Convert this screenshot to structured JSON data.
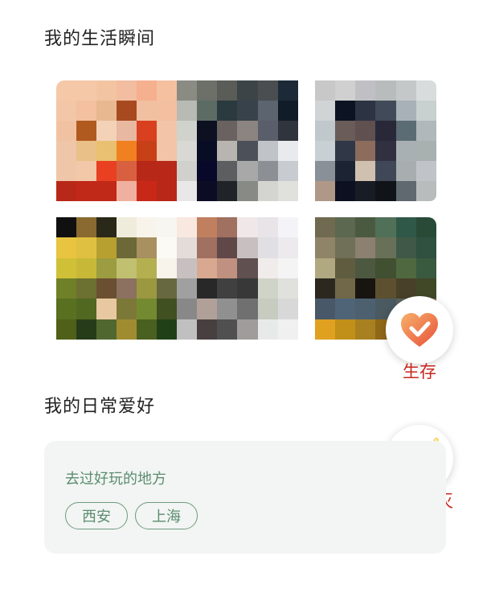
{
  "sections": {
    "moments_title": "我的生活瞬间",
    "hobbies_title": "我的日常爱好"
  },
  "photos": [
    {
      "name": "photo-1",
      "colors": [
        "#f5c8a8",
        "#f5c8a8",
        "#f3c4a2",
        "#f2bda0",
        "#f5b090",
        "#f5c0a0",
        "#f2c6a6",
        "#f3c0a0",
        "#e8b890",
        "#a84a20",
        "#f0c0a0",
        "#f2c0a0",
        "#f0c2a2",
        "#b05a20",
        "#f3d2b8",
        "#e8b8a0",
        "#d84020",
        "#f2c4a8",
        "#f0c6a8",
        "#e8c088",
        "#e8c070",
        "#f08020",
        "#c84018",
        "#f2c4a8",
        "#f0c6a8",
        "#f2c8a8",
        "#e84020",
        "#d86040",
        "#b82818",
        "#b82818",
        "#b82818",
        "#c02818",
        "#c02818",
        "#f0b0a0",
        "#c82818",
        "#b82818"
      ]
    },
    {
      "name": "photo-2",
      "colors": [
        "#8a8c84",
        "#6c7068",
        "#5a5c58",
        "#3c4448",
        "#4a4e50",
        "#1c2a38",
        "#b8bab4",
        "#5c6c64",
        "#2a3a3e",
        "#38424a",
        "#5c6470",
        "#101c28",
        "#d0d2cc",
        "#0c1020",
        "#6a6260",
        "#8c8480",
        "#5a5e6a",
        "#30343c",
        "#d8d8d4",
        "#080c24",
        "#b8b4b0",
        "#4c5058",
        "#c0c4c8",
        "#e8eaee",
        "#d0d0cc",
        "#08082a",
        "#5c5e60",
        "#a8a8a8",
        "#8c9094",
        "#c8ccd0",
        "#e8e8e8",
        "#0c0c24",
        "#202428",
        "#888a86",
        "#d4d4d0",
        "#e0e0dc"
      ]
    },
    {
      "name": "photo-3",
      "colors": [
        "#c8c8c8",
        "#d0d0d0",
        "#c0c0c4",
        "#b8bcbc",
        "#c4c8c8",
        "#d8dcdc",
        "#d0d4d4",
        "#0c1424",
        "#2c3444",
        "#404a58",
        "#a8b0b8",
        "#c8d0d0",
        "#c0c8cc",
        "#6a5c58",
        "#605050",
        "#282838",
        "#5c6c74",
        "#b0b8bc",
        "#c8d0d4",
        "#303848",
        "#8c6c5c",
        "#303040",
        "#a8b0b4",
        "#a8b0b0",
        "#8a9098",
        "#1c2434",
        "#d0c0b0",
        "#404858",
        "#a8aeb0",
        "#c0c4c8",
        "#b09888",
        "#0c1020",
        "#181c24",
        "#101418",
        "#606870",
        "#b8bcbc"
      ]
    },
    {
      "name": "photo-4",
      "colors": [
        "#101010",
        "#8a6a30",
        "#2a2818",
        "#f0ecdc",
        "#f8f4ec",
        "#f8f6f0",
        "#e8c440",
        "#e0c040",
        "#b8a030",
        "#6c6838",
        "#a89060",
        "#fcfaf4",
        "#d0c038",
        "#c8b838",
        "#9c9c40",
        "#c0c070",
        "#b4b050",
        "#f8f4ec",
        "#708028",
        "#6c7030",
        "#6a5030",
        "#8c7060",
        "#9c9840",
        "#686840",
        "#587020",
        "#506820",
        "#e8c8a0",
        "#7c7838",
        "#748a30",
        "#405020",
        "#506018",
        "#263c18",
        "#506830",
        "#a08c30",
        "#4a6020",
        "#204018"
      ]
    },
    {
      "name": "photo-5",
      "colors": [
        "#f8e8e0",
        "#c08060",
        "#a07060",
        "#f0e8e8",
        "#e8e4e8",
        "#f4f4f8",
        "#e4dcd8",
        "#a07060",
        "#604848",
        "#c8c0c0",
        "#e0e0e4",
        "#eceaec",
        "#c8c0c0",
        "#d8a890",
        "#c09080",
        "#605050",
        "#f0ecec",
        "#f4f4f4",
        "#a0a0a0",
        "#282828",
        "#404040",
        "#383838",
        "#d0d4c8",
        "#e0e0dc",
        "#888888",
        "#b0a098",
        "#909090",
        "#707070",
        "#c8ccc0",
        "#d8d8d8",
        "#c0c0c0",
        "#484040",
        "#505050",
        "#a09c9c",
        "#e8eaea",
        "#f0f0f0"
      ]
    },
    {
      "name": "photo-6",
      "colors": [
        "#706a50",
        "#5c6850",
        "#4a5a40",
        "#507058",
        "#305848",
        "#2a4a38",
        "#908468",
        "#707058",
        "#8c8070",
        "#687058",
        "#405848",
        "#305040",
        "#b0a880",
        "#605c40",
        "#4c5840",
        "#405030",
        "#506840",
        "#3a5a40",
        "#2c2820",
        "#706848",
        "#181410",
        "#5c5030",
        "#484028",
        "#404828",
        "#485868",
        "#506478",
        "#4c6070",
        "#4a5a60",
        "#5c6460",
        "#786050",
        "#e0a020",
        "#c09018",
        "#a88020",
        "#906818",
        "#806018",
        "#785820"
      ]
    }
  ],
  "float_buttons": {
    "survive_label": "生存",
    "destroy_label": "还是毁灭"
  },
  "hobbies_card": {
    "title": "去过好玩的地方",
    "tags": [
      "西安",
      "上海"
    ]
  },
  "colors": {
    "accent_red": "#c8281f",
    "heart_gradient_start": "#f6b06a",
    "heart_gradient_end": "#e8503a",
    "tag_green": "#5b8c6f"
  }
}
